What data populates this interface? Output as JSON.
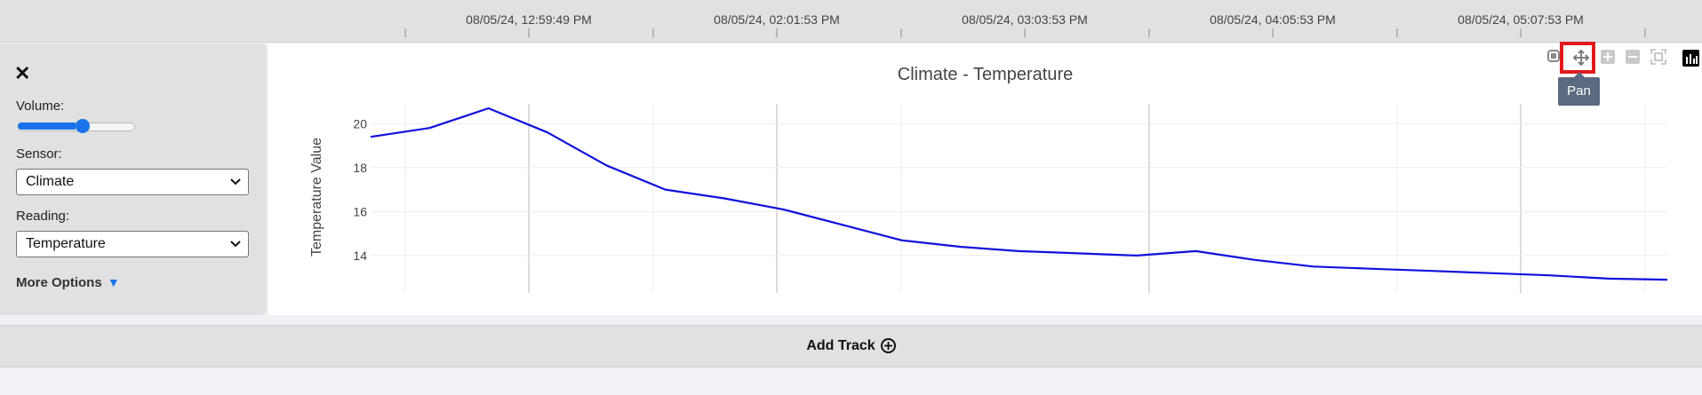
{
  "timeline": {
    "labels": [
      "08/05/24, 12:59:49 PM",
      "08/05/24, 02:01:53 PM",
      "08/05/24, 03:03:53 PM",
      "08/05/24, 04:05:53 PM",
      "08/05/24, 05:07:53 PM"
    ]
  },
  "controls": {
    "close_symbol": "✕",
    "volume_label": "Volume:",
    "volume_value": 0.5,
    "sensor_label": "Sensor:",
    "sensor_value": "Climate",
    "reading_label": "Reading:",
    "reading_value": "Temperature",
    "more_options_label": "More Options",
    "more_options_arrow": "▼"
  },
  "modebar": {
    "icons": [
      "camera-icon",
      "pan-icon",
      "zoom-in-icon",
      "zoom-out-icon",
      "autoscale-icon",
      "plotly-logo-icon"
    ],
    "tooltip": "Pan"
  },
  "chart_data": {
    "type": "line",
    "title": "Climate - Temperature",
    "ylabel": "Temperature Value",
    "xlabel": "",
    "y_ticks": [
      14,
      16,
      18,
      20
    ],
    "ylim": [
      12.3,
      20.9
    ],
    "series": [
      {
        "color": "#1010dd",
        "values": [
          19.4,
          19.8,
          20.7,
          19.6,
          18.1,
          17.0,
          16.6,
          16.1,
          15.4,
          14.7,
          14.4,
          14.2,
          14.1,
          14.0,
          14.2,
          13.8,
          13.5,
          13.4,
          13.3,
          13.2,
          13.1,
          12.95,
          12.9
        ]
      }
    ]
  },
  "add_track": {
    "label": "Add Track",
    "icon": "⊕"
  }
}
